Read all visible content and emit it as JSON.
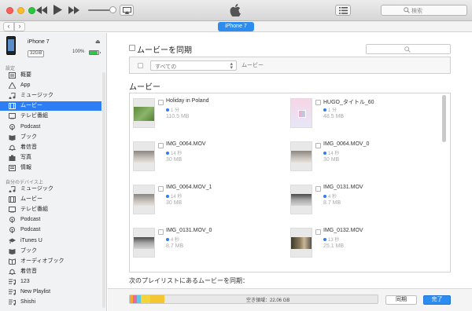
{
  "toolbar": {
    "search_placeholder": "検索",
    "icons": [
      "rewind-icon",
      "play-icon",
      "fast-forward-icon",
      "airplay-icon",
      "apple-logo-icon",
      "list-icon",
      "search-icon"
    ]
  },
  "nav": {
    "back": "‹",
    "forward": "›",
    "device_button": "iPhone 7"
  },
  "sidebar": {
    "device": {
      "name": "iPhone 7",
      "capacity": "32GB",
      "battery": "100%",
      "eject": "⏏"
    },
    "settings_header": "設定",
    "settings_items": [
      {
        "label": "概要",
        "icon": "summary-icon"
      },
      {
        "label": "App",
        "icon": "app-icon"
      },
      {
        "label": "ミュージック",
        "icon": "music-icon"
      },
      {
        "label": "ムービー",
        "icon": "movie-icon",
        "active": true
      },
      {
        "label": "テレビ番組",
        "icon": "tv-icon"
      },
      {
        "label": "Podcast",
        "icon": "podcast-icon"
      },
      {
        "label": "ブック",
        "icon": "book-icon"
      },
      {
        "label": "着信音",
        "icon": "bell-icon"
      },
      {
        "label": "写真",
        "icon": "camera-icon"
      },
      {
        "label": "情報",
        "icon": "info-icon"
      }
    ],
    "device_header": "自分のデバイス上",
    "device_items": [
      {
        "label": "ミュージック",
        "icon": "music-icon"
      },
      {
        "label": "ムービー",
        "icon": "movie-icon"
      },
      {
        "label": "テレビ番組",
        "icon": "tv-icon"
      },
      {
        "label": "Podcast",
        "icon": "podcast-icon"
      },
      {
        "label": "Podcast",
        "icon": "podcast-icon"
      },
      {
        "label": "iTunes U",
        "icon": "itunes-u-icon"
      },
      {
        "label": "ブック",
        "icon": "book-icon"
      },
      {
        "label": "オーディオブック",
        "icon": "audiobook-icon"
      },
      {
        "label": "着信音",
        "icon": "bell-icon"
      },
      {
        "label": "123",
        "icon": "playlist-icon"
      },
      {
        "label": "New Playlist",
        "icon": "playlist-icon"
      },
      {
        "label": "Shishi",
        "icon": "playlist-icon"
      }
    ]
  },
  "main": {
    "sync_label": "ムービーを同期",
    "filter_select": "すべての",
    "filter_suffix": "ムービー",
    "movies_heading": "ムービー",
    "movies": [
      {
        "title": "Holiday in Poland",
        "duration": "1 分",
        "size": "110.5 MB",
        "thumb": "grass"
      },
      {
        "title": "HUGO_タイトル_60",
        "duration": "1 分",
        "size": "48.5 MB",
        "thumb": "pastel"
      },
      {
        "title": "IMG_0064.MOV",
        "duration": "14 秒",
        "size": "30 MB",
        "thumb": "room"
      },
      {
        "title": "IMG_0064.MOV_0",
        "duration": "14 秒",
        "size": "30 MB",
        "thumb": "room"
      },
      {
        "title": "IMG_0064.MOV_1",
        "duration": "14 秒",
        "size": "30 MB",
        "thumb": "room"
      },
      {
        "title": "IMG_0131.MOV",
        "duration": "4 秒",
        "size": "8.7 MB",
        "thumb": "dark"
      },
      {
        "title": "IMG_0131.MOV_0",
        "duration": "4 秒",
        "size": "8.7 MB",
        "thumb": "dark"
      },
      {
        "title": "IMG_0132.MOV",
        "duration": "13 秒",
        "size": "25.1 MB",
        "thumb": "photo"
      }
    ],
    "playlist_label": "次のプレイリストにあるムービーを同期："
  },
  "footer": {
    "capacity_text": "空き領域：22.06 GB",
    "capacity_segments": [
      {
        "color": "#f0a830",
        "fraction": 0.012
      },
      {
        "color": "#e86aa0",
        "fraction": 0.016
      },
      {
        "color": "#63c7e8",
        "fraction": 0.016
      },
      {
        "color": "#f3d53a",
        "fraction": 0.04
      },
      {
        "color": "#f6c532",
        "fraction": 0.057
      }
    ],
    "sync_button": "同期",
    "done_button": "完了"
  }
}
